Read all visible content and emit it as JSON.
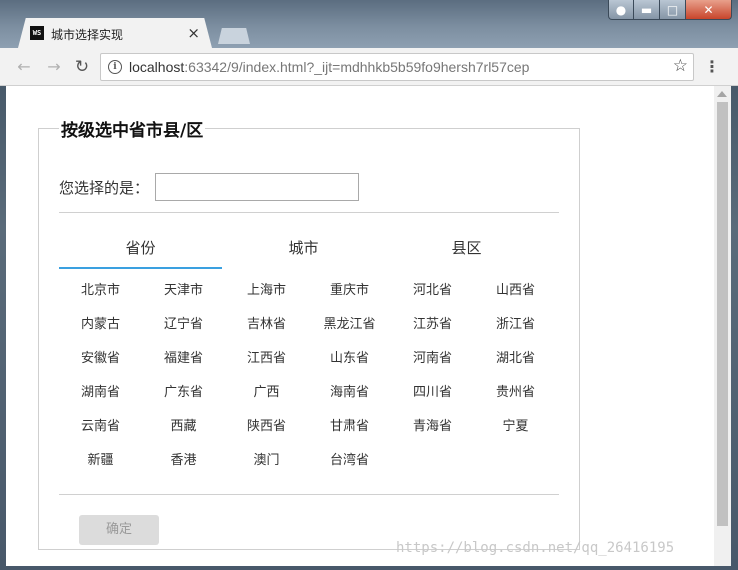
{
  "window": {
    "tab_title": "城市选择实现",
    "favicon_text": "WS"
  },
  "toolbar": {
    "url_host": "localhost",
    "url_rest": ":63342/9/index.html?_ijt=mdhhkb5b59fo9hersh7rl57cep"
  },
  "form": {
    "legend": "按级选中省市县/区",
    "selected_label": "您选择的是：",
    "selected_value": "",
    "tabs": [
      {
        "label": "省份",
        "active": true
      },
      {
        "label": "城市",
        "active": false
      },
      {
        "label": "县区",
        "active": false
      }
    ],
    "regions": [
      "北京市",
      "天津市",
      "上海市",
      "重庆市",
      "河北省",
      "山西省",
      "内蒙古",
      "辽宁省",
      "吉林省",
      "黑龙江省",
      "江苏省",
      "浙江省",
      "安徽省",
      "福建省",
      "江西省",
      "山东省",
      "河南省",
      "湖北省",
      "湖南省",
      "广东省",
      "广西",
      "海南省",
      "四川省",
      "贵州省",
      "云南省",
      "西藏",
      "陕西省",
      "甘肃省",
      "青海省",
      "宁夏",
      "新疆",
      "香港",
      "澳门",
      "台湾省"
    ],
    "confirm_label": "确定"
  },
  "watermark": "https://blog.csdn.net/qq_26416195",
  "colors": {
    "active_tab_underline": "#3aa0e0",
    "disabled_button": "#dcdcdc"
  }
}
